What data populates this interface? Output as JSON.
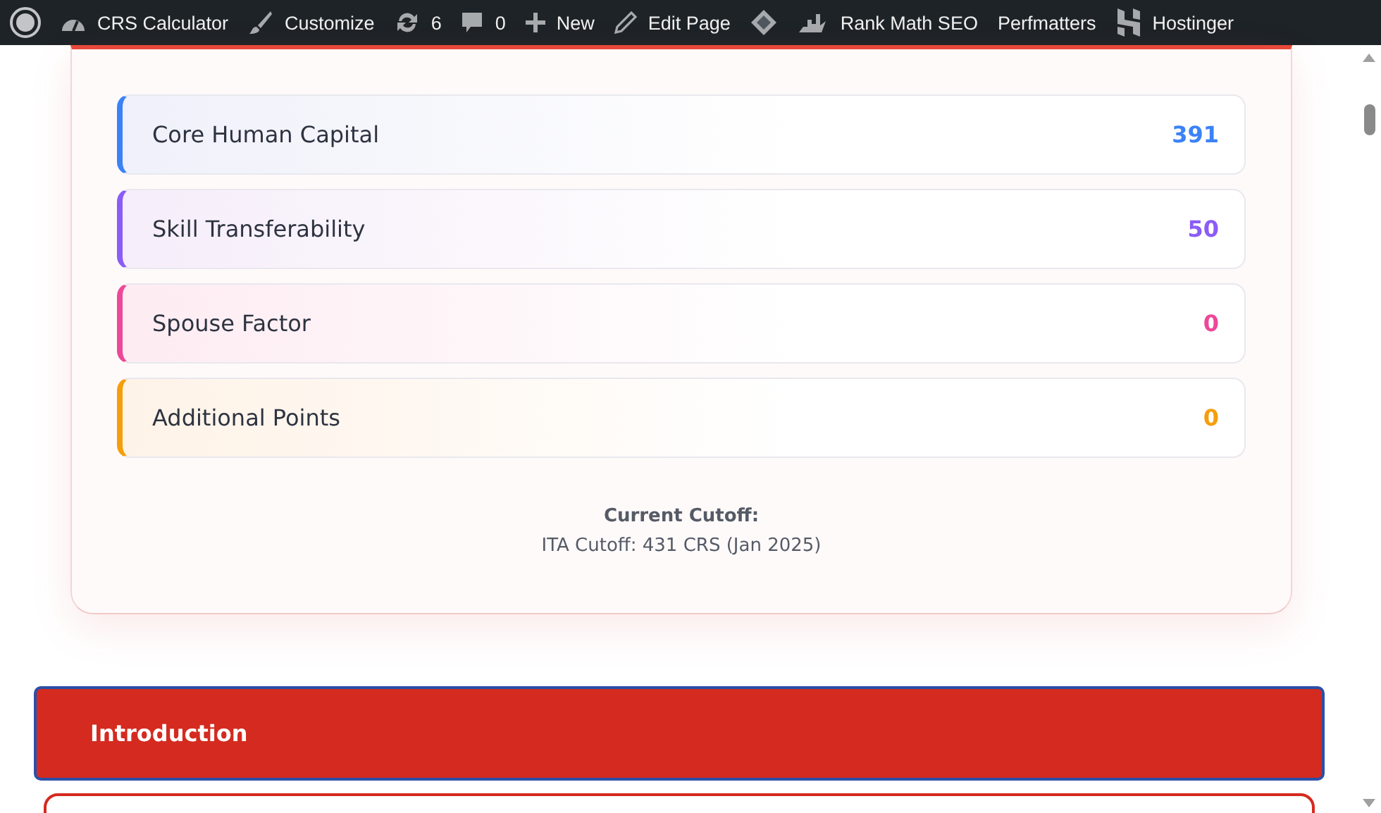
{
  "admin_bar": {
    "items": [
      {
        "kind": "logo"
      },
      {
        "kind": "gauge",
        "label": "CRS Calculator"
      },
      {
        "kind": "brush",
        "label": "Customize"
      },
      {
        "kind": "updates",
        "label": "6"
      },
      {
        "kind": "comments",
        "label": "0"
      },
      {
        "kind": "plus",
        "label": "New"
      },
      {
        "kind": "pencil",
        "label": "Edit Page"
      },
      {
        "kind": "diamond"
      },
      {
        "kind": "chart",
        "label": "Rank Math SEO"
      },
      {
        "kind": "none",
        "label": "Perfmatters"
      },
      {
        "kind": "hostinger",
        "label": "Hostinger"
      }
    ]
  },
  "breakdown": [
    {
      "label": "Core Human Capital",
      "value": "391",
      "color": "#3b82f6"
    },
    {
      "label": "Skill Transferability",
      "value": "50",
      "color": "#8b5cf6"
    },
    {
      "label": "Spouse Factor",
      "value": "0",
      "color": "#ec4899"
    },
    {
      "label": "Additional Points",
      "value": "0",
      "color": "#f59e0b"
    }
  ],
  "cutoff": {
    "title": "Current Cutoff:",
    "text": "ITA Cutoff: 431 CRS (Jan 2025)"
  },
  "section": {
    "title": "Introduction"
  }
}
